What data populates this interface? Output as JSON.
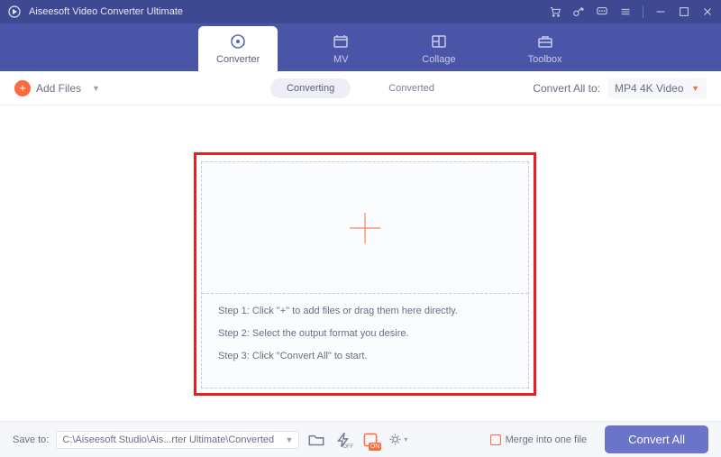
{
  "app": {
    "title": "Aiseesoft Video Converter Ultimate"
  },
  "tabs": [
    {
      "label": "Converter"
    },
    {
      "label": "MV"
    },
    {
      "label": "Collage"
    },
    {
      "label": "Toolbox"
    }
  ],
  "toolbar": {
    "add_files": "Add Files",
    "seg_converting": "Converting",
    "seg_converted": "Converted",
    "convert_all_to": "Convert All to:",
    "format": "MP4 4K Video"
  },
  "dropzone": {
    "step1": "Step 1: Click \"+\" to add files or drag them here directly.",
    "step2": "Step 2: Select the output format you desire.",
    "step3": "Step 3: Click \"Convert All\" to start."
  },
  "footer": {
    "save_to_label": "Save to:",
    "path": "C:\\Aiseesoft Studio\\Ais...rter Ultimate\\Converted",
    "merge_label": "Merge into one file",
    "convert_all": "Convert All"
  }
}
